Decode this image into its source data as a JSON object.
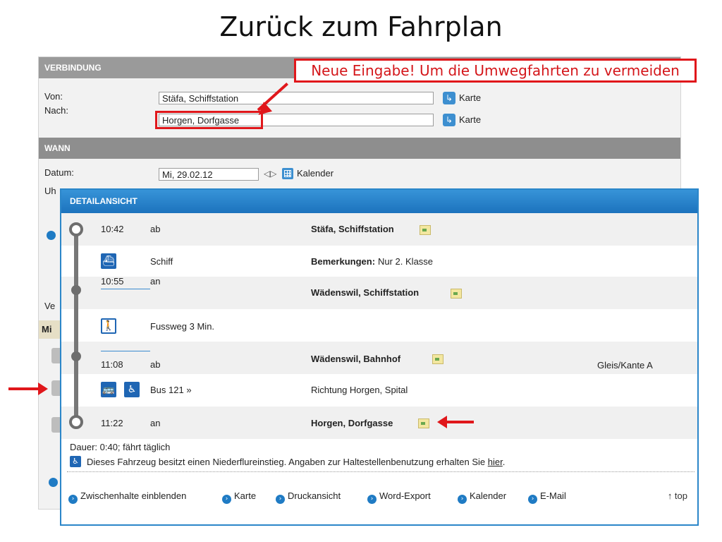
{
  "slide_title": "Zurück zum Fahrplan",
  "callout": "Neue Eingabe! Um die Umwegfahrten zu vermeiden",
  "form": {
    "verbindung_title": "VERBINDUNG",
    "von_label": "Von:",
    "von_value": "Stäfa, Schiffstation",
    "nach_label": "Nach:",
    "nach_value": "Horgen, Dorfgasse",
    "karte_label": "Karte",
    "wann_title": "WANN",
    "datum_label": "Datum:",
    "datum_value": "Mi, 29.02.12",
    "kalender_label": "Kalender",
    "uhr_partial": "Uh",
    "ve_partial": "Ve",
    "mi_partial": "Mi"
  },
  "detail": {
    "header": "DETAILANSICHT",
    "rows": [
      {
        "time": "10:42",
        "dir": "ab",
        "station": "Stäfa, Schiffstation"
      },
      {
        "transport": "Schiff",
        "remark_label": "Bemerkungen:",
        "remark": "Nur 2. Klasse"
      },
      {
        "time": "10:55",
        "dir": "an",
        "station": "Wädenswil, Schiffstation"
      },
      {
        "transport": "Fussweg 3 Min."
      },
      {
        "time": "11:08",
        "dir": "ab",
        "station": "Wädenswil, Bahnhof",
        "platform": "Gleis/Kante A"
      },
      {
        "transport": "Bus 121 »",
        "direction": "Richtung Horgen, Spital"
      },
      {
        "time": "11:22",
        "dir": "an",
        "station": "Horgen, Dorfgasse"
      }
    ],
    "duration": "Dauer: 0:40; fährt täglich",
    "lowfloor_text": "Dieses Fahrzeug besitzt einen Niederflureinstieg. Angaben zur Haltestellenbenutzung erhalten Sie",
    "lowfloor_link": "hier",
    "lowfloor_end": ".",
    "footer_links": [
      "Zwischenhalte einblenden",
      "Karte",
      "Druckansicht",
      "Word-Export",
      "Kalender",
      "E-Mail"
    ],
    "top_link": "↑ top"
  },
  "colors": {
    "accent": "#2b86c9",
    "annotation_red": "#e0171b",
    "header_grey": "#9a9a9a"
  }
}
